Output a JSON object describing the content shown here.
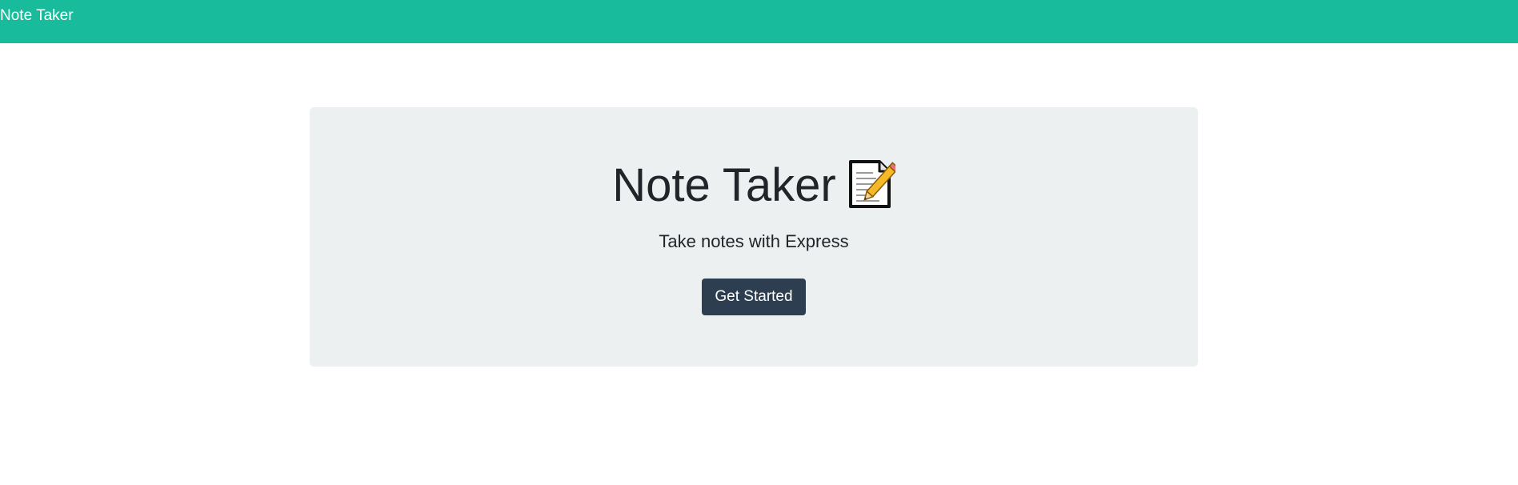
{
  "navbar": {
    "brand": "Note Taker",
    "background_color": "#18bc9c"
  },
  "hero": {
    "title": "Note Taker",
    "icon": "memo-icon",
    "subtitle": "Take notes with Express",
    "button_label": "Get Started",
    "background_color": "#ecf0f1",
    "button_color": "#2c3e50"
  }
}
